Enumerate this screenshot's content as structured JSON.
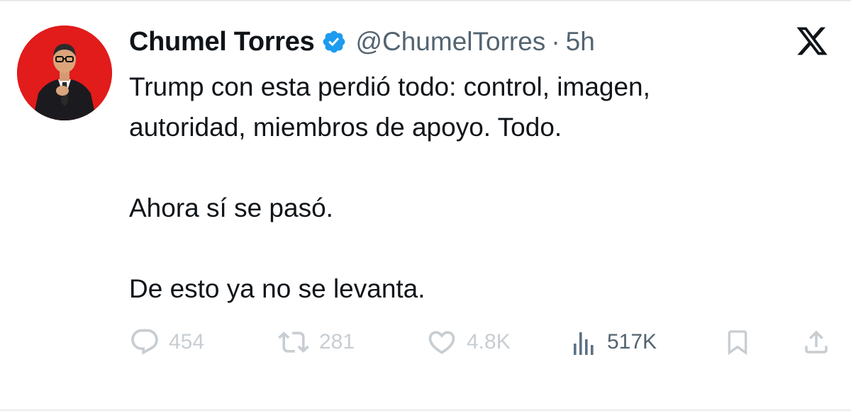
{
  "tweet": {
    "author_name": "Chumel Torres",
    "handle": "@ChumelTorres",
    "separator": "·",
    "time": "5h",
    "lines": [
      "Trump con esta perdió todo: control, imagen,",
      "autoridad, miembros de apoyo. Todo.",
      "Ahora sí se pasó.",
      "De esto ya no se levanta."
    ]
  },
  "actions": {
    "replies": "454",
    "reposts": "281",
    "likes": "4.8K",
    "views": "517K"
  },
  "icons": {
    "verified": "verified-badge-icon",
    "platform": "x-logo-icon",
    "reply": "reply-icon",
    "repost": "repost-icon",
    "like": "heart-icon",
    "views": "views-icon",
    "bookmark": "bookmark-icon",
    "share": "share-icon"
  },
  "colors": {
    "verified": "#1d9bf0",
    "avatar_background": "#e21b1b",
    "text": "#0f1419",
    "secondary": "#536471",
    "faded_icon": "#c7cdd2"
  }
}
